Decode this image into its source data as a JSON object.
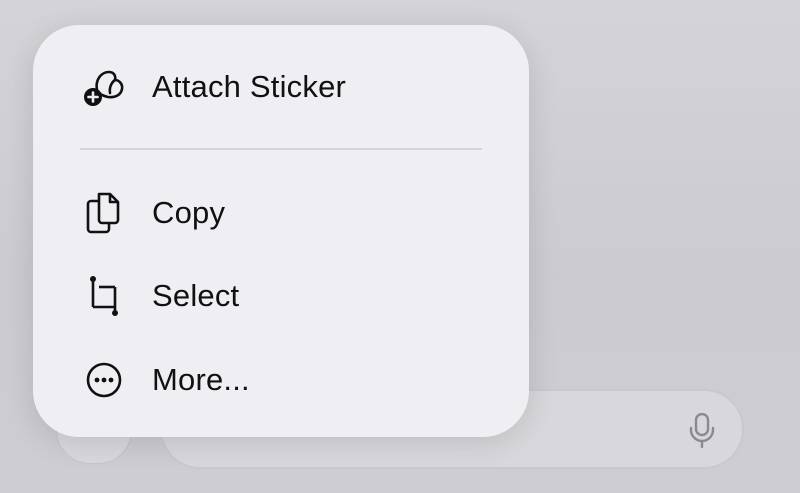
{
  "context_menu": {
    "items": [
      {
        "label": "Attach Sticker",
        "icon": "sticker-add-icon"
      },
      {
        "label": "Copy",
        "icon": "copy-documents-icon"
      },
      {
        "label": "Select",
        "icon": "crop-select-icon"
      },
      {
        "label": "More...",
        "icon": "ellipsis-circle-icon"
      }
    ]
  },
  "composer": {
    "add_button_icon": "plus-icon",
    "microphone_icon": "microphone-icon"
  },
  "colors": {
    "menu_background": "#efeff3",
    "text": "#111114",
    "backdrop": "#cfcfd4"
  }
}
